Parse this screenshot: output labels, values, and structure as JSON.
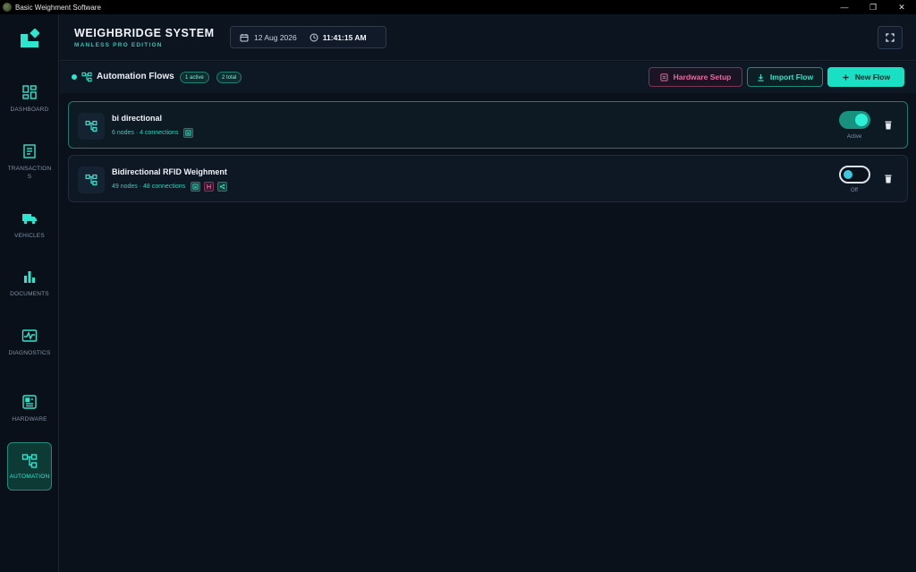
{
  "window": {
    "title": "Basic Weighment Software"
  },
  "sidebar": {
    "items": [
      {
        "label": "DASHBOARD",
        "icon": "dashboard-icon"
      },
      {
        "label": "TRANSACTIONS",
        "icon": "receipt-icon"
      },
      {
        "label": "VEHICLES",
        "icon": "truck-icon"
      },
      {
        "label": "DOCUMENTS",
        "icon": "bar-chart-icon"
      },
      {
        "label": "DIAGNOSTICS",
        "icon": "pulse-icon"
      },
      {
        "label": "HARDWARE",
        "icon": "chip-icon"
      },
      {
        "label": "AUTOMATION",
        "icon": "flow-icon",
        "active": true
      }
    ]
  },
  "header": {
    "title": "WEIGHBRIDGE SYSTEM",
    "subtitle": "MANLESS PRO EDITION",
    "date": "12 Aug 2026",
    "time": "11:41:15 AM"
  },
  "toolbar": {
    "title": "Automation Flows",
    "active_count": "1 active",
    "total_count": "2 total",
    "hardware_setup": "Hardware Setup",
    "import_flow": "Import Flow",
    "new_flow": "New Flow"
  },
  "flows": [
    {
      "name": "bi directional",
      "meta": "6 nodes · 4 connections",
      "status": "Active",
      "enabled": true
    },
    {
      "name": "Bidirectional RFID Weighment",
      "meta": "49 nodes · 48 connections",
      "status": "Off",
      "enabled": false
    }
  ],
  "colors": {
    "accent": "#19e0c4",
    "pink": "#e76aa0",
    "background": "#0b111b"
  }
}
